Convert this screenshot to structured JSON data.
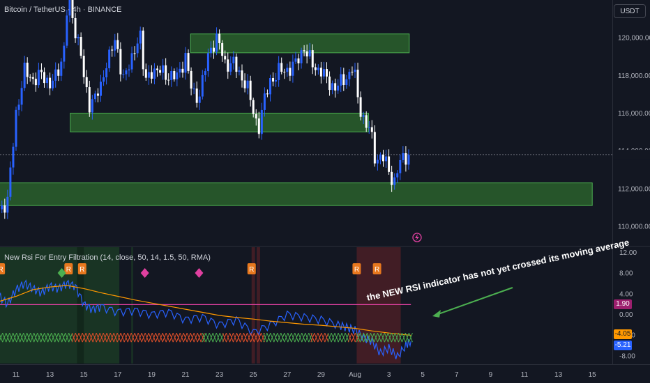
{
  "header": {
    "title": "Bitcoin / TetherUS · 4h · BINANCE",
    "currency_button": "USDT"
  },
  "indicator": {
    "title": "New Rsi For Entry Filtration (14, close, 50, 14, 1.5, 50, RMA)",
    "value_magenta": "1.90",
    "value_orange": "-4.05",
    "value_blue": "-5.21"
  },
  "annotation": {
    "text": "the NEW RSI indicator has not yet crossed its moving average"
  },
  "colors": {
    "background": "#131722",
    "bull": "#2962ff",
    "bear": "#ffffff",
    "zone_fill": "#2e6b2e",
    "zone_border": "#4caf50",
    "rsi_line": "#2962ff",
    "ma_line": "#ff9800",
    "level_line": "#e040a0",
    "annotation_arrow": "#4caf50"
  },
  "chart_data": [
    {
      "type": "candlestick",
      "title": "Bitcoin / TetherUS · 4h · BINANCE",
      "ylim": [
        109000,
        122000
      ],
      "y_ticks": [
        "120,000.00",
        "118,000.00",
        "116,000.00",
        "114,000.00",
        "112,000.00",
        "110,000.00"
      ],
      "y_tick_values": [
        120000,
        118000,
        116000,
        114000,
        112000,
        110000
      ],
      "x_ticks": [
        "11",
        "13",
        "15",
        "17",
        "19",
        "21",
        "23",
        "25",
        "27",
        "29",
        "Aug",
        "3",
        "5",
        "7",
        "9",
        "11",
        "13",
        "15"
      ],
      "x_tick_days": [
        11,
        13,
        15,
        17,
        19,
        21,
        23,
        25,
        27,
        29,
        31,
        33,
        35,
        37,
        39,
        41,
        43,
        45
      ],
      "current_price": 113800,
      "zones": [
        {
          "day_start": 21.3,
          "day_end": 34.2,
          "low": 119200,
          "high": 120200
        },
        {
          "day_start": 14.2,
          "day_end": 31.8,
          "low": 115000,
          "high": 116000
        },
        {
          "day_start": 10.0,
          "day_end": 45.0,
          "low": 111100,
          "high": 112300
        }
      ],
      "path": [
        [
          10.0,
          110900
        ],
        [
          10.5,
          111300
        ],
        [
          11.0,
          116000
        ],
        [
          11.5,
          118200
        ],
        [
          12.0,
          117800
        ],
        [
          12.5,
          118000
        ],
        [
          13.0,
          117600
        ],
        [
          13.4,
          117900
        ],
        [
          13.8,
          119200
        ],
        [
          14.1,
          122600
        ],
        [
          14.4,
          120500
        ],
        [
          14.8,
          119600
        ],
        [
          15.0,
          117800
        ],
        [
          15.3,
          116300
        ],
        [
          15.6,
          117000
        ],
        [
          16.0,
          117200
        ],
        [
          16.4,
          119000
        ],
        [
          16.8,
          119800
        ],
        [
          17.3,
          118000
        ],
        [
          17.8,
          118600
        ],
        [
          18.3,
          120500
        ],
        [
          18.6,
          117500
        ],
        [
          19.0,
          118300
        ],
        [
          19.5,
          118200
        ],
        [
          20.0,
          118000
        ],
        [
          20.5,
          117900
        ],
        [
          21.0,
          119000
        ],
        [
          21.4,
          117000
        ],
        [
          21.8,
          116900
        ],
        [
          22.2,
          118500
        ],
        [
          22.5,
          119500
        ],
        [
          22.9,
          120000
        ],
        [
          23.3,
          118600
        ],
        [
          23.8,
          118700
        ],
        [
          24.2,
          118000
        ],
        [
          24.6,
          117600
        ],
        [
          25.0,
          116000
        ],
        [
          25.3,
          115200
        ],
        [
          25.6,
          116500
        ],
        [
          26.0,
          117700
        ],
        [
          26.5,
          118200
        ],
        [
          27.0,
          118300
        ],
        [
          27.5,
          118600
        ],
        [
          28.0,
          119500
        ],
        [
          28.3,
          118900
        ],
        [
          28.6,
          118400
        ],
        [
          29.0,
          118300
        ],
        [
          29.4,
          117600
        ],
        [
          29.8,
          117400
        ],
        [
          30.2,
          117600
        ],
        [
          30.6,
          118000
        ],
        [
          30.9,
          118600
        ],
        [
          31.2,
          116500
        ],
        [
          31.6,
          115500
        ],
        [
          31.9,
          115100
        ],
        [
          32.2,
          113500
        ],
        [
          32.6,
          113800
        ],
        [
          33.0,
          112900
        ],
        [
          33.3,
          112300
        ],
        [
          33.6,
          113300
        ],
        [
          34.0,
          113700
        ],
        [
          34.3,
          113900
        ]
      ]
    },
    {
      "type": "line",
      "title": "New Rsi For Entry Filtration (14, close, 50, 14, 1.5, 50, RMA)",
      "ylim": [
        -9.5,
        13
      ],
      "y_ticks": [
        "12.00",
        "8.00",
        "4.00",
        "0.00",
        "-4.00",
        "-8.00"
      ],
      "y_tick_values": [
        12,
        8,
        4,
        0,
        -4,
        -8
      ],
      "level": 1.9,
      "series": [
        {
          "x": [
            10.0,
            10.5,
            11.0,
            11.5,
            12.0,
            12.5,
            13.0,
            13.5,
            14.0,
            14.5,
            15.0,
            15.5,
            16.0,
            17.0,
            18.0,
            19.0,
            20.0,
            21.0,
            22.0,
            23.0,
            24.0,
            25.0,
            26.0,
            27.0,
            28.0,
            29.0,
            30.0,
            30.5,
            31.0,
            31.5,
            32.0,
            32.5,
            33.0,
            33.5,
            34.0,
            34.3
          ],
          "y": [
            3.5,
            2.0,
            4.8,
            6.0,
            5.0,
            4.2,
            5.5,
            5.0,
            6.0,
            5.5,
            2.0,
            1.0,
            1.5,
            0.5,
            0.8,
            0.0,
            0.5,
            -1.0,
            -0.5,
            -2.0,
            -1.0,
            -3.5,
            -2.0,
            0.0,
            -0.5,
            -1.0,
            -2.0,
            -2.5,
            -3.0,
            -4.5,
            -5.2,
            -7.5,
            -6.5,
            -8.2,
            -6.0,
            -5.21
          ]
        },
        {
          "x": [
            10.0,
            11.0,
            12.0,
            13.0,
            14.0,
            15.0,
            16.0,
            17.0,
            18.0,
            19.0,
            20.0,
            21.0,
            22.0,
            23.0,
            24.0,
            25.0,
            26.0,
            27.0,
            28.0,
            29.0,
            30.0,
            31.0,
            32.0,
            33.0,
            34.3
          ],
          "y": [
            2.5,
            3.5,
            4.8,
            5.3,
            5.6,
            5.0,
            4.2,
            3.5,
            2.8,
            2.2,
            1.6,
            1.0,
            0.4,
            -0.2,
            -0.6,
            -0.9,
            -1.3,
            -1.6,
            -1.9,
            -2.1,
            -2.4,
            -2.7,
            -3.2,
            -3.6,
            -4.05
          ]
        }
      ],
      "markers_R": [
        10.1,
        14.1,
        14.9,
        24.9,
        31.1,
        32.3
      ],
      "markers_diamond": [
        [
          13.7,
          "#4caf50"
        ],
        [
          18.6,
          "#e040a0"
        ],
        [
          21.8,
          "#e040a0"
        ]
      ]
    }
  ]
}
